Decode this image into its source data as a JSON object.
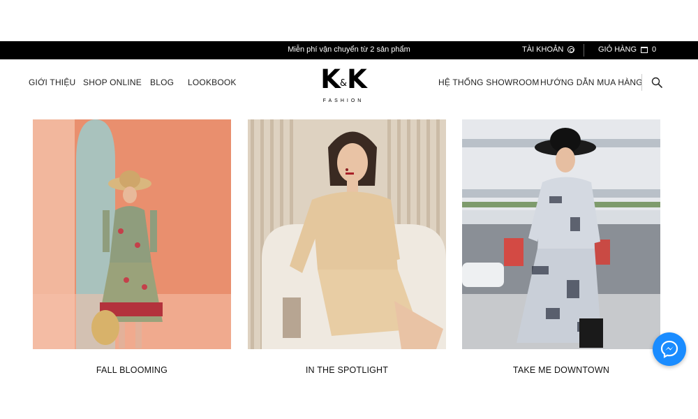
{
  "topbar": {
    "promo": "Miễn phí vận chuyển từ 2 sản phẩm",
    "account_label": "TÀI KHOẢN",
    "cart_label": "GIỎ HÀNG",
    "cart_count": "0"
  },
  "nav": {
    "left": [
      "GIỚI THIỆU",
      "SHOP ONLINE",
      "BLOG",
      "LOOKBOOK"
    ],
    "right": [
      "HỆ THỐNG SHOWROOM",
      "HƯỚNG DẪN MUA HÀNG"
    ]
  },
  "logo": {
    "mark_left": "K",
    "mark_amp": "&",
    "mark_right": "K",
    "sub": "FASHION"
  },
  "collections": [
    {
      "title": "FALL BLOOMING"
    },
    {
      "title": "IN THE SPOTLIGHT"
    },
    {
      "title": "TAKE ME DOWNTOWN"
    }
  ],
  "colors": {
    "topbar_bg": "#000000",
    "messenger": "#1a8cff"
  }
}
